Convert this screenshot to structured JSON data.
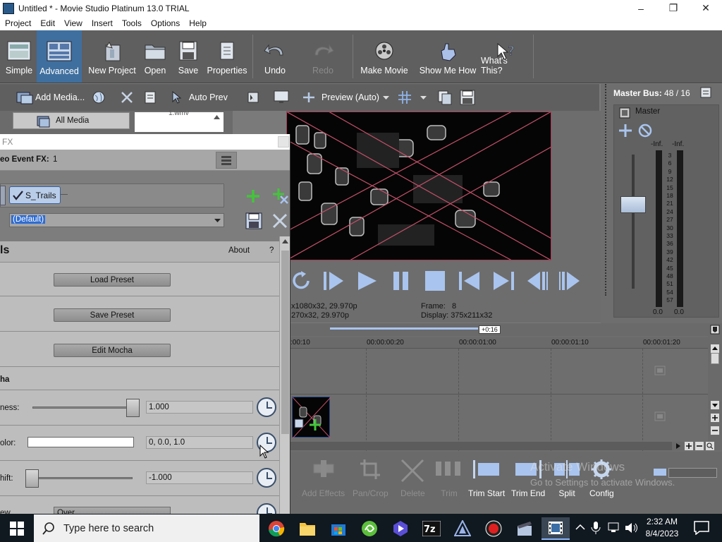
{
  "window": {
    "title": "Untitled * - Movie Studio Platinum 13.0 TRIAL"
  },
  "menu": [
    "Project",
    "Edit",
    "View",
    "Insert",
    "Tools",
    "Options",
    "Help"
  ],
  "toolbar": {
    "simple": "Simple",
    "advanced": "Advanced",
    "new_project": "New Project",
    "open": "Open",
    "save": "Save",
    "properties": "Properties",
    "undo": "Undo",
    "redo": "Redo",
    "make_movie": "Make Movie",
    "show_me_how": "Show Me How",
    "whats_this": "What's This?"
  },
  "media": {
    "add_media": "Add Media...",
    "auto_preview": "Auto Prev",
    "all_media": "All Media",
    "file": "1.wmv"
  },
  "preview": {
    "mode": "Preview (Auto)",
    "project": "x1080x32, 29.970p",
    "preview_res": "270x32, 29.970p",
    "frame_label": "Frame:",
    "frame_value": "8",
    "display_label": "Display:",
    "display_value": "375x211x32"
  },
  "master": {
    "title": "Master Bus:",
    "value": "48 / 16",
    "label": "Master",
    "left_peak": "-Inf.",
    "right_peak": "-Inf.",
    "left_db": "0.0",
    "right_db": "0.0",
    "scale": [
      "3",
      "6",
      "9",
      "12",
      "15",
      "18",
      "21",
      "24",
      "27",
      "30",
      "33",
      "36",
      "39",
      "42",
      "45",
      "48",
      "51",
      "54",
      "57"
    ]
  },
  "fx": {
    "window_title": "FX",
    "chain_label": "eo Event FX:",
    "chain_value": "1",
    "plugin": "S_Trails",
    "preset": "(Default)",
    "section": "ls",
    "about": "About",
    "help": "?",
    "load_preset": "Load Preset",
    "save_preset": "Save Preset",
    "edit_mocha": "Edit Mocha",
    "group": "ha",
    "param1_label": "ness:",
    "param1_value": "1.000",
    "param2_label": "olor:",
    "param2_value": "0, 0.0, 1.0",
    "param3_label": "hift:",
    "param3_value": "-1.000",
    "param4_label": "ew",
    "param4_value": "Over"
  },
  "timeline": {
    "cursor": "+0:16",
    "ticks": [
      ":00:10",
      "00:00:00:20",
      "00:00:01:00",
      "00:00:01:10",
      "00:00:01:20"
    ]
  },
  "bottom_tools": {
    "add_effects": "Add Effects",
    "pan_crop": "Pan/Crop",
    "delete": "Delete",
    "trim": "Trim",
    "trim_start": "Trim Start",
    "trim_end": "Trim End",
    "split": "Split",
    "config": "Config",
    "watermark1": "Activate Windows",
    "watermark2": "Go to Settings to activate Windows."
  },
  "taskbar": {
    "search_placeholder": "Type here to search",
    "time": "2:32 AM",
    "date": "8/4/2023"
  }
}
